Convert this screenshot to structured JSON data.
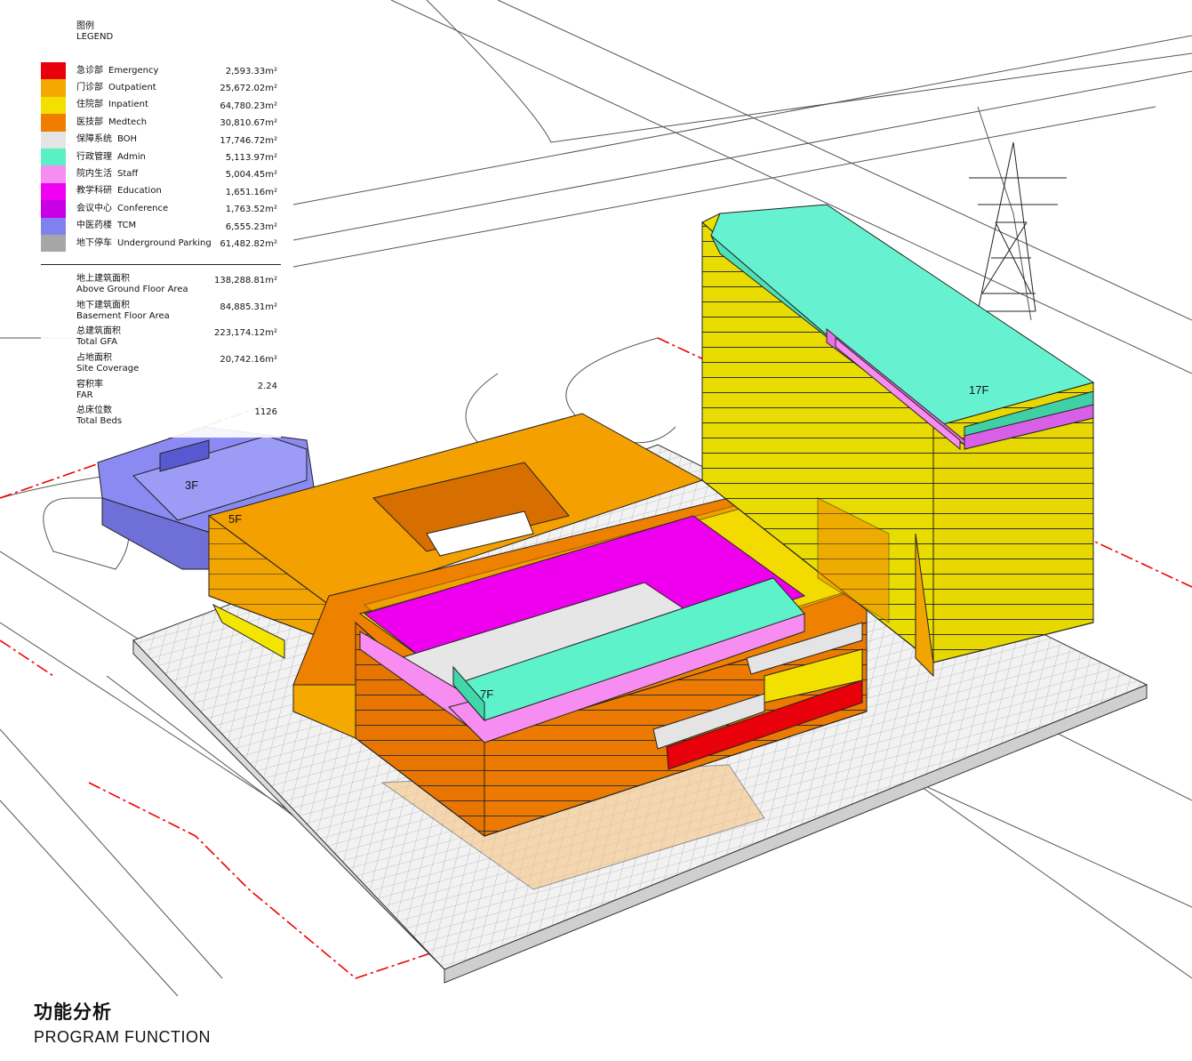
{
  "legend": {
    "title_cn": "图例",
    "title_en": "LEGEND",
    "items": [
      {
        "cn": "急诊部",
        "en": "Emergency",
        "area": "2,593.33m²",
        "color": "#e8000b"
      },
      {
        "cn": "门诊部",
        "en": "Outpatient",
        "area": "25,672.02m²",
        "color": "#f5a800"
      },
      {
        "cn": "住院部",
        "en": "Inpatient",
        "area": "64,780.23m²",
        "color": "#f2e100"
      },
      {
        "cn": "医技部",
        "en": "Medtech",
        "area": "30,810.67m²",
        "color": "#f07d00"
      },
      {
        "cn": "保障系统",
        "en": "BOH",
        "area": "17,746.72m²",
        "color": "#e4e4e4"
      },
      {
        "cn": "行政管理",
        "en": "Admin",
        "area": "5,113.97m²",
        "color": "#59f0c4"
      },
      {
        "cn": "院内生活",
        "en": "Staff",
        "area": "5,004.45m²",
        "color": "#f78df0"
      },
      {
        "cn": "教学科研",
        "en": "Education",
        "area": "1,651.16m²",
        "color": "#f000f0"
      },
      {
        "cn": "会议中心",
        "en": "Conference",
        "area": "1,763.52m²",
        "color": "#c800e6"
      },
      {
        "cn": "中医药楼",
        "en": "TCM",
        "area": "6,555.23m²",
        "color": "#8080f0"
      },
      {
        "cn": "地下停车",
        "en": "Underground Parking",
        "area": "61,482.82m²",
        "color": "#a6a6a6"
      }
    ]
  },
  "stats": [
    {
      "cn": "地上建筑面积",
      "en": "Above Ground Floor Area",
      "value": "138,288.81m²"
    },
    {
      "cn": "地下建筑面积",
      "en": "Basement Floor Area",
      "value": "84,885.31m²"
    },
    {
      "cn": "总建筑面积",
      "en": "Total GFA",
      "value": "223,174.12m²"
    },
    {
      "cn": "占地面积",
      "en": "Site Coverage",
      "value": "20,742.16m²"
    },
    {
      "cn": "容积率",
      "en": "FAR",
      "value": "2.24"
    },
    {
      "cn": "总床位数",
      "en": "Total Beds",
      "value": "1126"
    }
  ],
  "floor_labels": {
    "tcm": "3F",
    "outpatient": "5F",
    "medtech": "7F",
    "inpatient": "17F"
  },
  "title": {
    "cn": "功能分析",
    "en": "PROGRAM FUNCTION"
  }
}
